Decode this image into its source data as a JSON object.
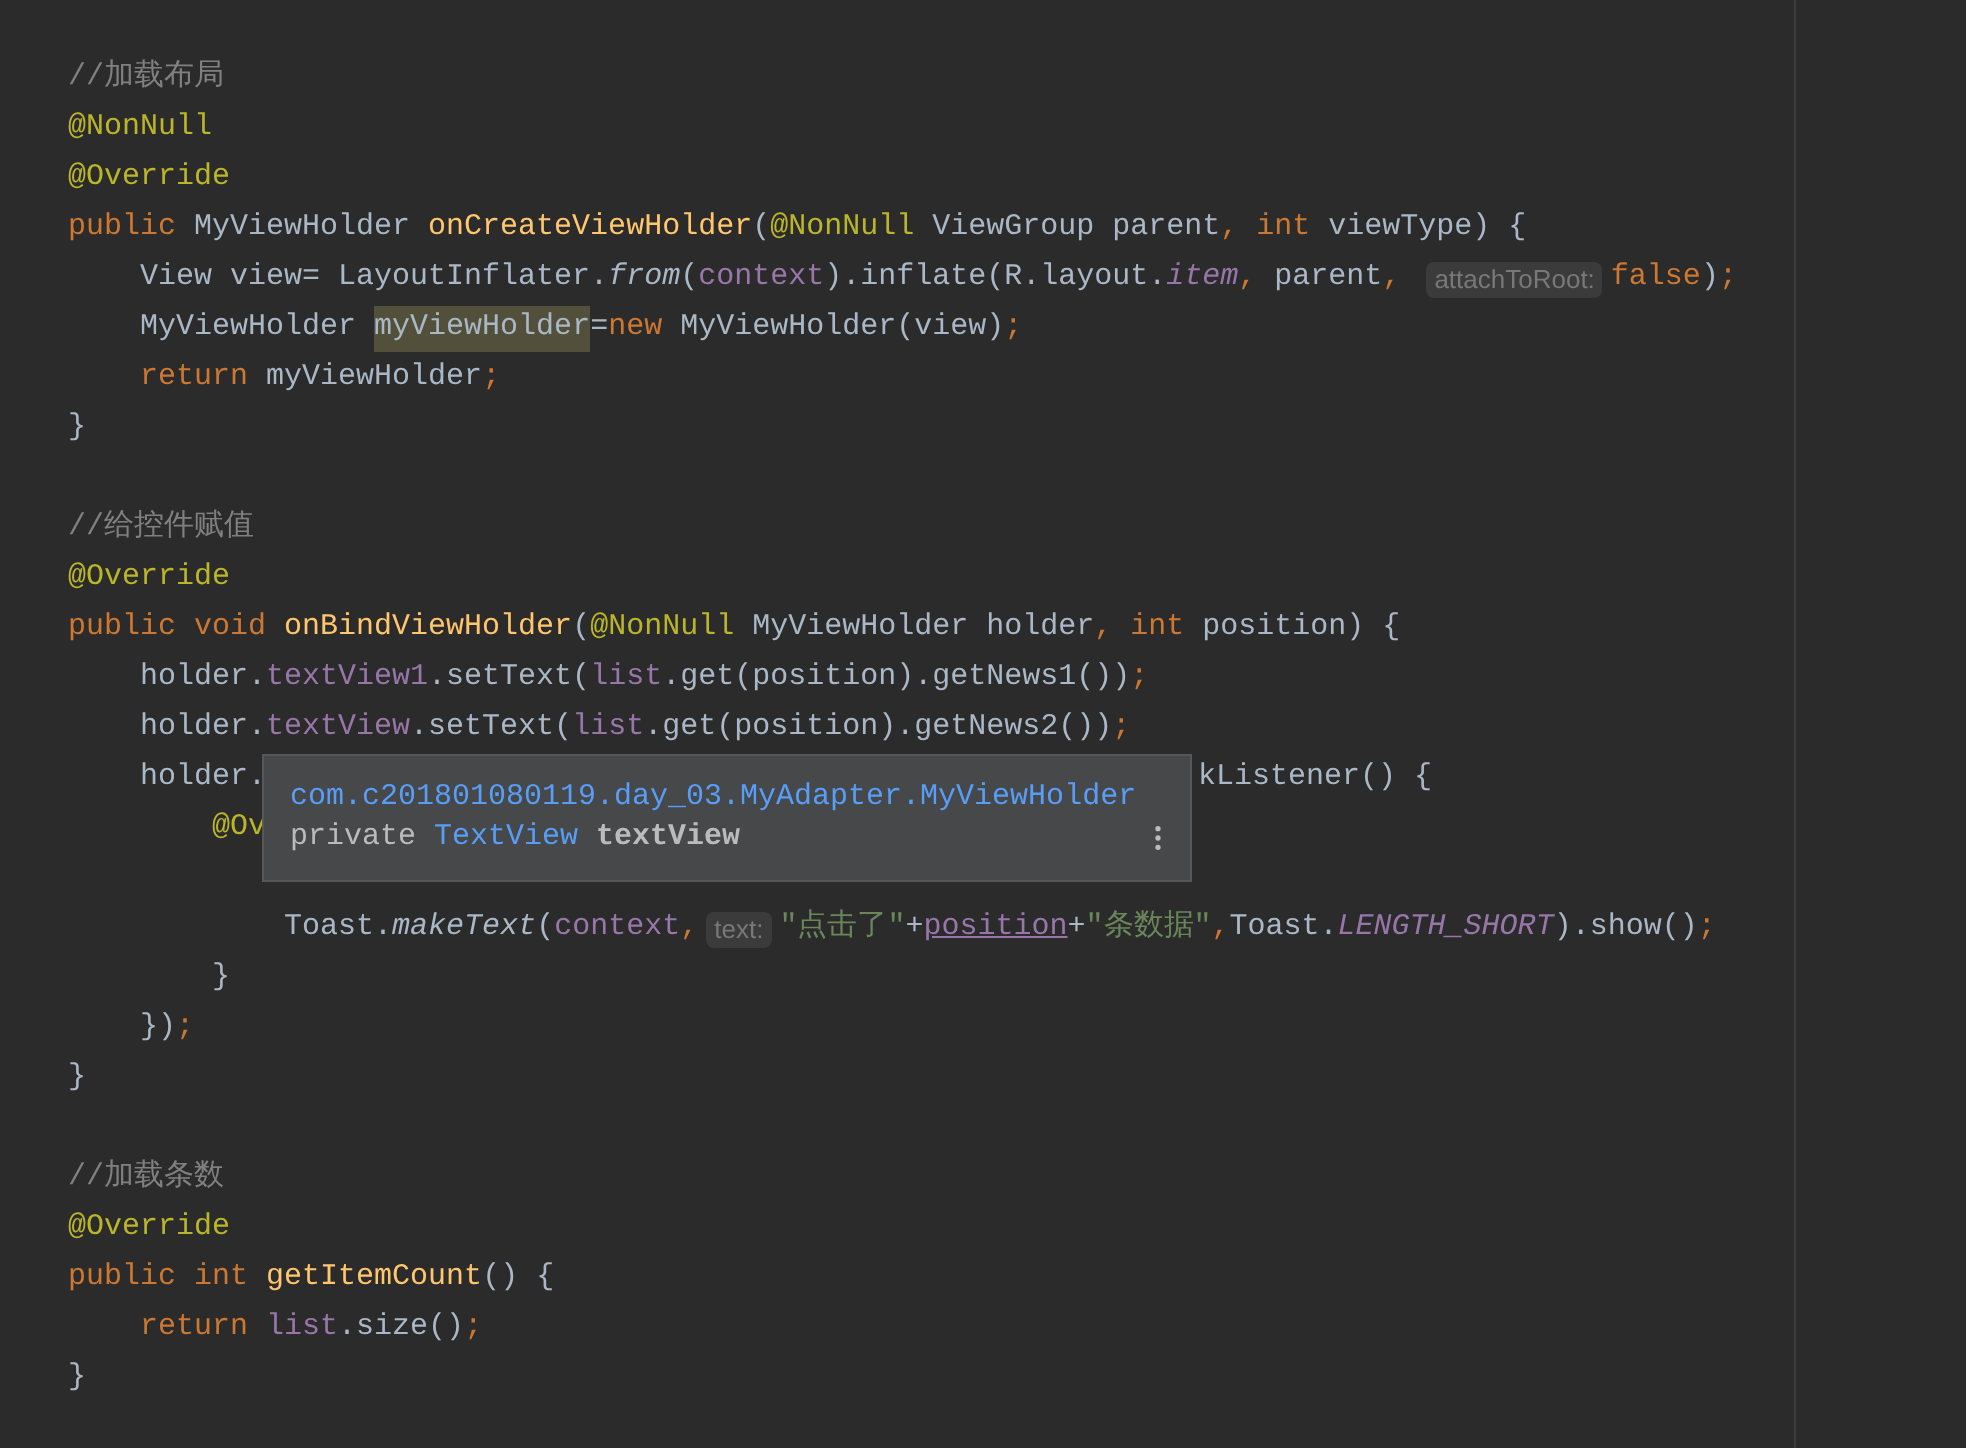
{
  "editor": {
    "lines": [
      {
        "kind": "code",
        "tokens": [
          {
            "kind": "comment",
            "text": "//加载布局"
          }
        ]
      },
      {
        "kind": "code",
        "tokens": [
          {
            "kind": "annotation",
            "text": "@NonNull"
          }
        ]
      },
      {
        "kind": "code",
        "tokens": [
          {
            "kind": "annotation",
            "text": "@Override"
          }
        ]
      },
      {
        "kind": "code",
        "tokens": [
          {
            "kind": "keyword",
            "text": "public "
          },
          {
            "kind": "plain",
            "text": "MyViewHolder "
          },
          {
            "kind": "method",
            "text": "onCreateViewHolder"
          },
          {
            "kind": "plain",
            "text": "("
          },
          {
            "kind": "annotation",
            "text": "@NonNull"
          },
          {
            "kind": "plain",
            "text": " ViewGroup parent"
          },
          {
            "kind": "keyword",
            "text": ", int "
          },
          {
            "kind": "plain",
            "text": "viewType) {"
          }
        ]
      },
      {
        "kind": "code",
        "tokens": [
          {
            "kind": "plain",
            "text": "    View view= LayoutInflater."
          },
          {
            "kind": "static-method",
            "text": "from"
          },
          {
            "kind": "plain",
            "text": "("
          },
          {
            "kind": "field",
            "text": "context"
          },
          {
            "kind": "plain",
            "text": ").inflate(R.layout."
          },
          {
            "kind": "static-field",
            "text": "item"
          },
          {
            "kind": "keyword",
            "text": ", "
          },
          {
            "kind": "plain",
            "text": "parent"
          },
          {
            "kind": "keyword",
            "text": ", "
          },
          {
            "kind": "hint",
            "text": "attachToRoot:"
          },
          {
            "kind": "keyword",
            "text": "false"
          },
          {
            "kind": "plain",
            "text": ")"
          },
          {
            "kind": "keyword",
            "text": ";"
          }
        ]
      },
      {
        "kind": "code",
        "tokens": [
          {
            "kind": "plain",
            "text": "    MyViewHolder "
          },
          {
            "kind": "highlight",
            "text": "myViewHolder"
          },
          {
            "kind": "plain",
            "text": "="
          },
          {
            "kind": "keyword",
            "text": "new "
          },
          {
            "kind": "plain",
            "text": "MyViewHolder(view)"
          },
          {
            "kind": "keyword",
            "text": ";"
          }
        ]
      },
      {
        "kind": "code",
        "tokens": [
          {
            "kind": "keyword",
            "text": "    return "
          },
          {
            "kind": "plain",
            "text": "myViewHolder"
          },
          {
            "kind": "keyword",
            "text": ";"
          }
        ]
      },
      {
        "kind": "code",
        "tokens": [
          {
            "kind": "plain",
            "text": "}"
          }
        ]
      },
      {
        "kind": "blank"
      },
      {
        "kind": "code",
        "tokens": [
          {
            "kind": "comment",
            "text": "//给控件赋值"
          }
        ]
      },
      {
        "kind": "code",
        "tokens": [
          {
            "kind": "annotation",
            "text": "@Override"
          }
        ]
      },
      {
        "kind": "code",
        "tokens": [
          {
            "kind": "keyword",
            "text": "public void "
          },
          {
            "kind": "method",
            "text": "onBindViewHolder"
          },
          {
            "kind": "plain",
            "text": "("
          },
          {
            "kind": "annotation",
            "text": "@NonNull"
          },
          {
            "kind": "plain",
            "text": " MyViewHolder holder"
          },
          {
            "kind": "keyword",
            "text": ", int "
          },
          {
            "kind": "plain",
            "text": "position) {"
          }
        ]
      },
      {
        "kind": "code",
        "tokens": [
          {
            "kind": "plain",
            "text": "    holder."
          },
          {
            "kind": "field",
            "text": "textView1"
          },
          {
            "kind": "plain",
            "text": ".setText("
          },
          {
            "kind": "field",
            "text": "list"
          },
          {
            "kind": "plain",
            "text": ".get(position).getNews1())"
          },
          {
            "kind": "keyword",
            "text": ";"
          }
        ]
      },
      {
        "kind": "code",
        "tokens": [
          {
            "kind": "plain",
            "text": "    holder."
          },
          {
            "kind": "field",
            "text": "textView"
          },
          {
            "kind": "plain",
            "text": ".setText("
          },
          {
            "kind": "field",
            "text": "list"
          },
          {
            "kind": "plain",
            "text": ".get(position).getNews2())"
          },
          {
            "kind": "keyword",
            "text": ";"
          }
        ]
      },
      {
        "kind": "code",
        "tokens": [
          {
            "kind": "plain",
            "text": "    holder."
          }
        ],
        "tail": [
          {
            "kind": "plain",
            "text": "kListener() {"
          }
        ]
      },
      {
        "kind": "code",
        "tokens": [
          {
            "kind": "annotation",
            "text": "        @Ov"
          }
        ]
      },
      {
        "kind": "blank"
      },
      {
        "kind": "code",
        "tokens": [
          {
            "kind": "plain",
            "text": "            Toast."
          },
          {
            "kind": "static-method",
            "text": "makeText"
          },
          {
            "kind": "plain",
            "text": "("
          },
          {
            "kind": "field",
            "text": "context"
          },
          {
            "kind": "keyword",
            "text": ","
          },
          {
            "kind": "hint",
            "text": "text:"
          },
          {
            "kind": "string",
            "text": "\"点击了\""
          },
          {
            "kind": "plain",
            "text": "+"
          },
          {
            "kind": "captured",
            "text": "position"
          },
          {
            "kind": "plain",
            "text": "+"
          },
          {
            "kind": "string",
            "text": "\"条数据\""
          },
          {
            "kind": "keyword",
            "text": ","
          },
          {
            "kind": "plain",
            "text": "Toast."
          },
          {
            "kind": "static-field",
            "text": "LENGTH_SHORT"
          },
          {
            "kind": "plain",
            "text": ").show()"
          },
          {
            "kind": "keyword",
            "text": ";"
          }
        ]
      },
      {
        "kind": "code",
        "tokens": [
          {
            "kind": "plain",
            "text": "        }"
          }
        ]
      },
      {
        "kind": "code",
        "tokens": [
          {
            "kind": "plain",
            "text": "    })"
          },
          {
            "kind": "keyword",
            "text": ";"
          }
        ]
      },
      {
        "kind": "code",
        "tokens": [
          {
            "kind": "plain",
            "text": "}"
          }
        ]
      },
      {
        "kind": "blank"
      },
      {
        "kind": "code",
        "tokens": [
          {
            "kind": "comment",
            "text": "//加载条数"
          }
        ]
      },
      {
        "kind": "code",
        "tokens": [
          {
            "kind": "annotation",
            "text": "@Override"
          }
        ]
      },
      {
        "kind": "code",
        "tokens": [
          {
            "kind": "keyword",
            "text": "public int "
          },
          {
            "kind": "method",
            "text": "getItemCount"
          },
          {
            "kind": "plain",
            "text": "() {"
          }
        ]
      },
      {
        "kind": "code",
        "tokens": [
          {
            "kind": "keyword",
            "text": "    return "
          },
          {
            "kind": "field",
            "text": "list"
          },
          {
            "kind": "plain",
            "text": ".size()"
          },
          {
            "kind": "keyword",
            "text": ";"
          }
        ]
      },
      {
        "kind": "code",
        "tokens": [
          {
            "kind": "plain",
            "text": "}"
          }
        ]
      }
    ]
  },
  "quick_doc": {
    "path": "com.c201801080119.day_03.MyAdapter.MyViewHolder",
    "signature": [
      {
        "kind": "plain",
        "text": "private "
      },
      {
        "kind": "type",
        "text": "TextView"
      },
      {
        "kind": "name",
        "text": "textView"
      }
    ]
  }
}
